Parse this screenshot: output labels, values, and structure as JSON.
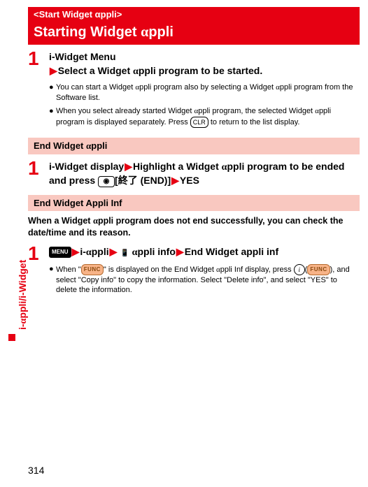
{
  "banner": {
    "top": "<Start Widget αppli>",
    "title_prefix": "Starting Widget ",
    "title_suffix": "ppli"
  },
  "step1": {
    "num": "1",
    "line1": "i-Widget Menu",
    "line2_prefix": "Select a Widget ",
    "line2_suffix": "ppli program to be started.",
    "bullet1_a": "You can start a Widget ",
    "bullet1_b": "ppli program also by selecting a Widget ",
    "bullet1_c": "ppli program from the Software list.",
    "bullet2_a": "When you select already started Widget ",
    "bullet2_b": "ppli program, the selected Widget ",
    "bullet2_c": "ppli program is displayed separately. Press ",
    "bullet2_d": " to return to the list display.",
    "key_clr": "CLR"
  },
  "end_banner": {
    "prefix": "End Widget ",
    "suffix": "ppli"
  },
  "step2": {
    "num": "1",
    "a": "i-Widget display",
    "b": "Highlight a Widget ",
    "c": "ppli program to be ended and press ",
    "d": "[終了 (END)]",
    "e": "YES",
    "key_cam": "◉"
  },
  "inf_banner": "End Widget Appli Inf",
  "inf_intro_a": "When a Widget ",
  "inf_intro_b": "ppli program does not end successfully, you can check the date/time and its reason.",
  "step3": {
    "num": "1",
    "a": "i-",
    "b": "ppli",
    "c": "ppli info",
    "d": "End Widget appli inf",
    "key_menu": "MENU",
    "bullet_a": "When \"",
    "bullet_b": "\" is displayed on the End Widget ",
    "bullet_c": "ppli Inf display, press ",
    "bullet_d": "(",
    "bullet_e": "), and select \"Copy info\" to copy the information. Select \"Delete info\", and select \"YES\" to delete the information.",
    "key_func": "FUNC",
    "key_i": "i"
  },
  "vtab_a": "i-",
  "vtab_b": "ppli/i-Widget",
  "page_number": "314",
  "phone_glyph": "📱",
  "alpha": "α"
}
